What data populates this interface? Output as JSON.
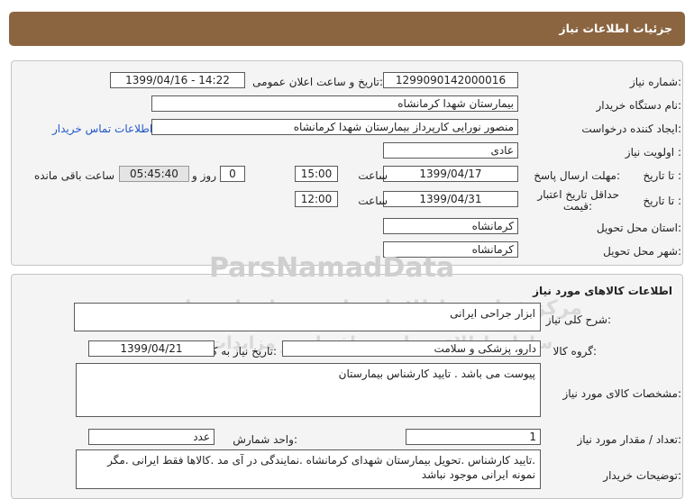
{
  "header": {
    "title": "جزئیات اطلاعات نیاز"
  },
  "fields": {
    "need_number_label": "شماره نیاز:",
    "need_number": "1299090142000016",
    "announce_label": "تاریخ و ساعت اعلان عمومی:",
    "announce_value": "1399/04/16 - 14:22",
    "buyer_org_label": "نام دستگاه خریدار:",
    "buyer_org": "بیمارستان شهدا کرمانشاه",
    "creator_label": "ایجاد کننده درخواست:",
    "creator": "منصور نورایی کارپرداز بیمارستان شهدا کرمانشاه",
    "contact_link": "اطلاعات تماس خریدار",
    "priority_label": "اولویت نیاز :",
    "priority": "عادی",
    "reply_label": "مهلت ارسال پاسخ:",
    "to_date_label": "تا تاریخ :",
    "reply_date": "1399/04/17",
    "time_label": "ساعت",
    "reply_time": "15:00",
    "days_value": "0",
    "days_label": "روز و",
    "remaining_time": "05:45:40",
    "remaining_label": "ساعت باقی مانده",
    "validity_label_1": "حداقل تاریخ اعتبار",
    "validity_label_2": "قیمت:",
    "validity_to_label": "تا تاریخ :",
    "validity_date": "1399/04/31",
    "validity_time_label": "ساعت",
    "validity_time": "12:00",
    "province_label": "استان محل تحویل:",
    "province": "کرمانشاه",
    "city_label": "شهر محل تحویل:",
    "city": "کرمانشاه"
  },
  "goods": {
    "title": "اطلاعات کالاهای مورد نیاز",
    "general_desc_label": "شرح کلی نیاز:",
    "general_desc": "ابزار جراحی ایرانی",
    "group_label": "گروه کالا:",
    "group": "دارو، پزشکی و سلامت",
    "need_date_label": "تاریخ نیاز به کالا:",
    "need_date": "1399/04/21",
    "specs_label": "مشخصات کالای مورد نیاز:",
    "specs": "پیوست می باشد . تایید کارشناس بیمارستان",
    "qty_label": "تعداد / مقدار مورد نیاز:",
    "qty": "1",
    "unit_label": "واحد شمارش:",
    "unit": "عدد",
    "buyer_notes_label": "توضیحات خریدار:",
    "buyer_notes": ".تایید کارشناس .تحویل بیمارستان شهدای کرمانشاه .نمایندگی در آی مد .کالاها فقط ایرانی .مگر نمونه ایرانی موجود نباشد"
  },
  "watermark": {
    "brand": "ParsNamadData",
    "line1": "مرکز فراوری اطلاعات پارس نماد داده ها",
    "line2": "سامانه اطلاع رسانی مناقصات و مزایدات",
    "phone": "۰۲۱-۸۸۳۴۹۶۷۰-۵"
  }
}
